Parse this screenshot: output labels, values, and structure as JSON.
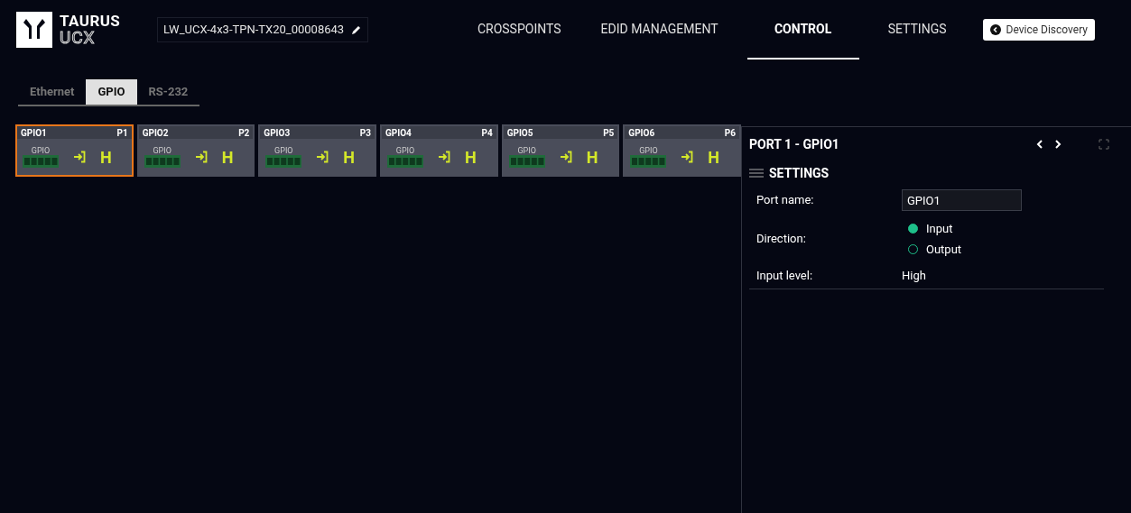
{
  "logo": {
    "line_1": "TAURUS",
    "line_2": "UCX"
  },
  "device_name": "LW_UCX-4x3-TPN-TX20_00008643",
  "nav": [
    {
      "label": "CROSSPOINTS",
      "selected": false
    },
    {
      "label": "EDID MANAGEMENT",
      "selected": false
    },
    {
      "label": "CONTROL",
      "selected": true
    },
    {
      "label": "SETTINGS",
      "selected": false
    }
  ],
  "discovery_button": "Device Discovery",
  "tabs": [
    {
      "label": "Ethernet",
      "selected": false
    },
    {
      "label": "GPIO",
      "selected": true
    },
    {
      "label": "RS-232",
      "selected": false
    }
  ],
  "ports": [
    {
      "name": "GPIO1",
      "port": "P1",
      "connector": "GPIO",
      "level": "H",
      "selected": true
    },
    {
      "name": "GPIO2",
      "port": "P2",
      "connector": "GPIO",
      "level": "H",
      "selected": false
    },
    {
      "name": "GPIO3",
      "port": "P3",
      "connector": "GPIO",
      "level": "H",
      "selected": false
    },
    {
      "name": "GPIO4",
      "port": "P4",
      "connector": "GPIO",
      "level": "H",
      "selected": false
    },
    {
      "name": "GPIO5",
      "port": "P5",
      "connector": "GPIO",
      "level": "H",
      "selected": false
    },
    {
      "name": "GPIO6",
      "port": "P6",
      "connector": "GPIO",
      "level": "H",
      "selected": false
    }
  ],
  "panel": {
    "title": "PORT 1 - GPIO1",
    "section": "SETTINGS",
    "port_name": {
      "label": "Port name:",
      "value": "GPIO1"
    },
    "direction": {
      "label": "Direction:",
      "options": [
        {
          "label": "Input",
          "selected": true
        },
        {
          "label": "Output",
          "selected": false
        }
      ]
    },
    "input_level": {
      "label": "Input level:",
      "value": "High"
    }
  }
}
